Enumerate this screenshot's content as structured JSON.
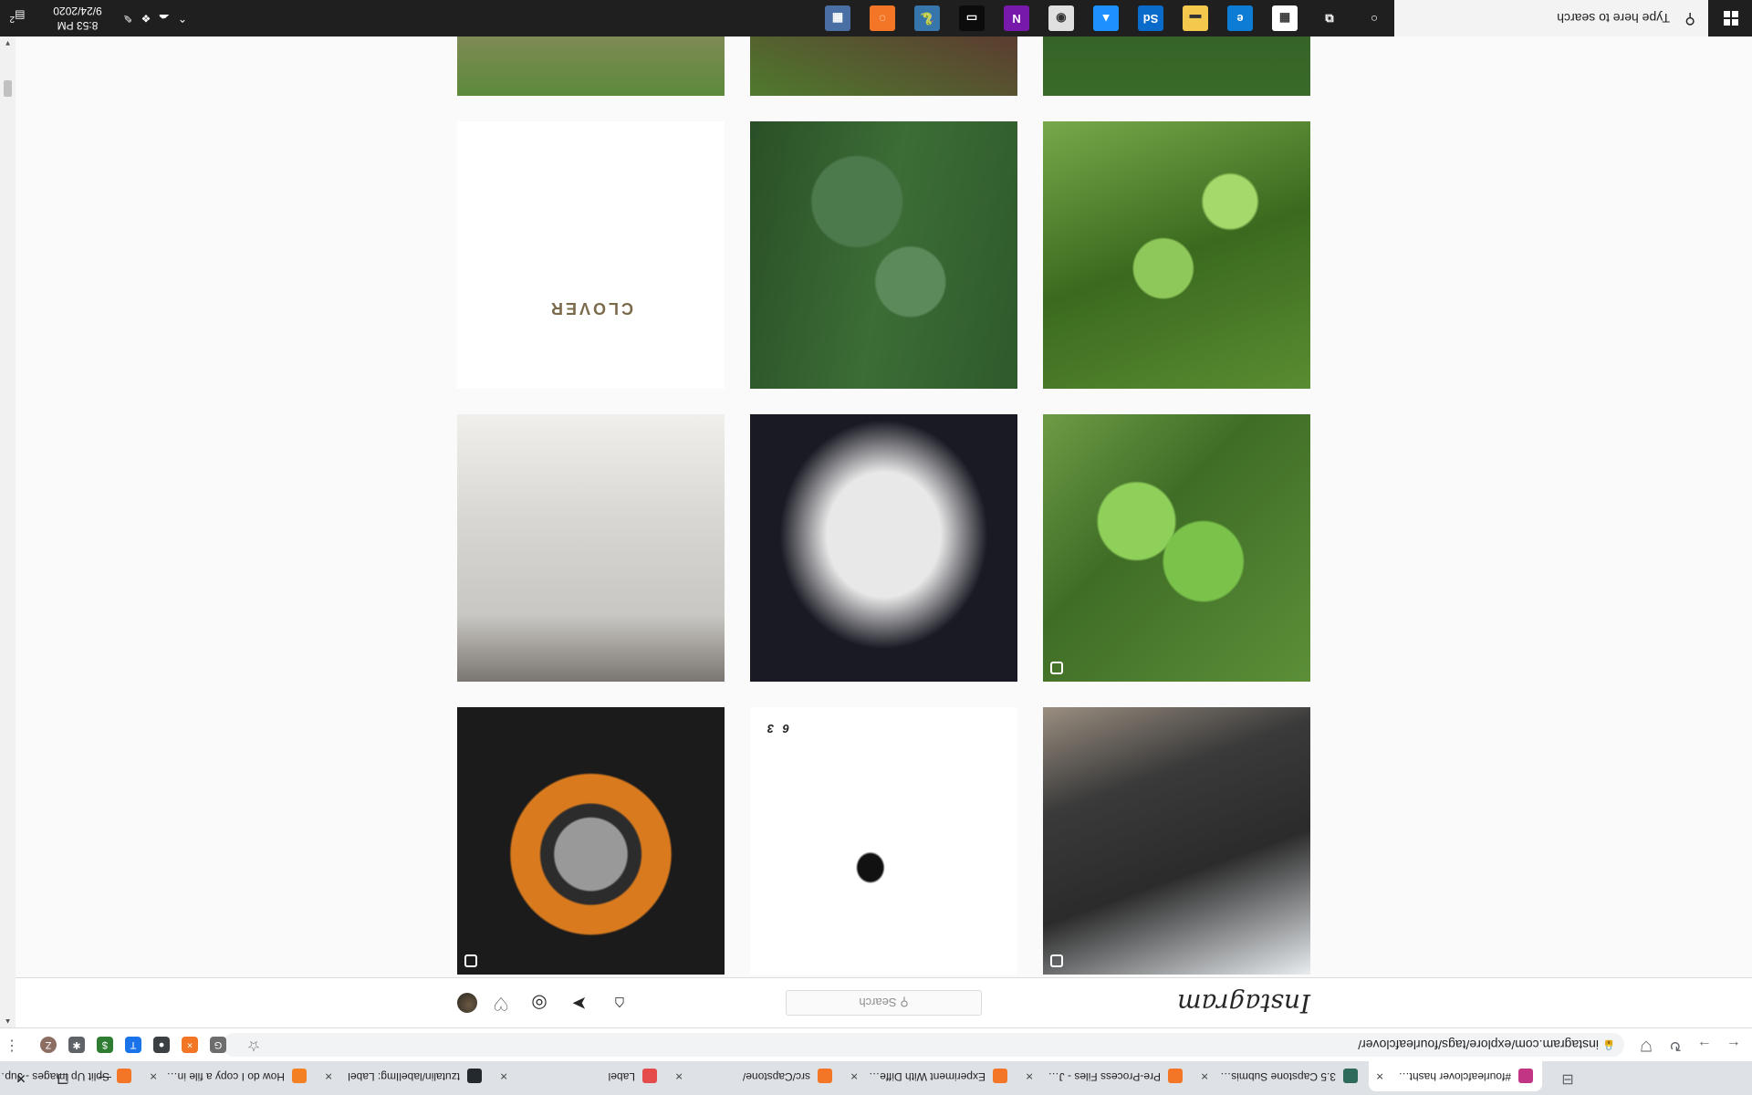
{
  "browser": {
    "tabs": [
      {
        "label": "#fourleafclover hashtag on",
        "favicon_color": "#c13584",
        "active": true
      },
      {
        "label": "3.5 Capstone Submission - ",
        "favicon_color": "#2e6b5a",
        "active": false
      },
      {
        "label": "Pre-Process Files - Jupyter",
        "favicon_color": "#f37626",
        "active": false
      },
      {
        "label": "Experiment With Different",
        "favicon_color": "#f37626",
        "active": false
      },
      {
        "label": "src/Capstone/",
        "favicon_color": "#f37626",
        "active": false
      },
      {
        "label": "Label",
        "favicon_color": "#e54b4b",
        "active": false
      },
      {
        "label": "tzutalin/labelImg: Label",
        "favicon_color": "#24292e",
        "active": false
      },
      {
        "label": "How do I copy a file in Pyth",
        "favicon_color": "#f48024",
        "active": false
      },
      {
        "label": "Split Up Images - Jupyter N",
        "favicon_color": "#f37626",
        "active": false
      }
    ],
    "url": "instagram.com/explore/tags/fourleafclover/",
    "extensions": [
      {
        "icon": "g-icon",
        "color": "#6d6d6d",
        "glyph": "G"
      },
      {
        "icon": "x-icon",
        "color": "#f37626",
        "glyph": "×"
      },
      {
        "icon": "circle-icon",
        "color": "#3c4043",
        "glyph": "●"
      },
      {
        "icon": "translate-icon",
        "color": "#1a73e8",
        "glyph": "T"
      },
      {
        "icon": "dollar-icon",
        "color": "#2e7d32",
        "glyph": "$"
      },
      {
        "icon": "puzzle-icon",
        "color": "#5f6368",
        "glyph": "✱"
      },
      {
        "icon": "profile-avatar",
        "color": "#8d6e63",
        "glyph": "Z"
      }
    ]
  },
  "instagram": {
    "logo": "Instagram",
    "search_placeholder": "Search",
    "search_icon_glyph": "⚲",
    "posts": [
      {
        "alt": "clover-bucket",
        "bg": "linear-gradient(160deg,#e8ecef 0%,#2b2b2b 40%,#3a3a3a 70%,#9a8e80 100%)"
      },
      {
        "alt": "clover-tattoo-drawing",
        "bg": "radial-gradient(ellipse at 55% 40%,#111 0 6%,#fff 7%) , #fff",
        "caption": "6 3"
      },
      {
        "alt": "clover-badge-anniversary",
        "bg": "radial-gradient(circle at 50% 45%,#999 0 18%,#2c2c2c 19% 25%,#d97a1e 26% 40%,#1b1b1b 41%)"
      },
      {
        "alt": "clover-patch-green",
        "bg": "radial-gradient(circle at 40% 45%,#7ac24a 0 18%,transparent 19%),radial-gradient(circle at 65% 60%,#8fd05a 0 16%,transparent 17%),linear-gradient(135deg,#5c8f38,#3f6d26 60%,#6d9b45)"
      },
      {
        "alt": "four-leaf-clover-selfie",
        "bg": "radial-gradient(ellipse at 50% 55%,#e8e8e8 0 30%,#1a1a24 55%),#22222c"
      },
      {
        "alt": "car-showroom",
        "bg": "linear-gradient(180deg,#7a7670 0%,#c9c7c3 25%,#d8d6d2 60%,#f0efec 100%)"
      },
      {
        "alt": "clover-grass-closeup",
        "bg": "radial-gradient(circle at 55% 45%,#8fc85a 0 14%,transparent 15%),radial-gradient(circle at 30% 70%,#a6d96b 0 10%,transparent 11%),linear-gradient(160deg,#5a8c32,#3b6a1e 50%,#77a84a)"
      },
      {
        "alt": "clover-in-grass",
        "bg": "radial-gradient(circle at 40% 40%,#5c8a5a 0 15%,transparent 16%),radial-gradient(circle at 60% 70%,#4d7a4d 0 18%,transparent 19%),linear-gradient(100deg,#2f5a2c,#3c6d36 50%,#2a4f27)"
      },
      {
        "alt": "clover-confetti",
        "bg": "#ffffff",
        "caption": "CLOVER"
      },
      {
        "alt": "clover-in-hand",
        "bg": "radial-gradient(circle at 55% 60%,#4a7a3a 0 20%,transparent 21%),linear-gradient(180deg,#3a6a2a,#2d5a22 60%,#d4a48a 85%,#e2b59a)"
      },
      {
        "alt": "clover-on-wood",
        "bg": "linear-gradient(200deg,#4f7a2e 0%,#5b4030 40%,#3d2a1e 100%)"
      },
      {
        "alt": "clover-shop-display",
        "bg": "linear-gradient(180deg,#5c8a3a 0%,#9a8a6a 40%,#d7c6a2 70%,#7ab0c8 100%)"
      }
    ],
    "multi_post_indices": [
      0,
      1,
      2,
      3
    ]
  },
  "taskbar": {
    "search_placeholder": "Type here to search",
    "time": "8:53 PM",
    "date": "9/24/2020",
    "notification_count": "2",
    "apps": [
      {
        "icon": "cortana-icon",
        "color": "#1f1f1f",
        "glyph": "○"
      },
      {
        "icon": "task-view-icon",
        "color": "#1f1f1f",
        "glyph": "⧉"
      },
      {
        "icon": "store-icon",
        "color": "#ffffff",
        "glyph": "▦"
      },
      {
        "icon": "edge-icon",
        "color": "#0c7cd5",
        "glyph": "e"
      },
      {
        "icon": "file-explorer-icon",
        "color": "#f2c94c",
        "glyph": "▬"
      },
      {
        "icon": "photoshop-icon",
        "color": "#0b6bcb",
        "glyph": "Sd"
      },
      {
        "icon": "photos-icon",
        "color": "#1e90ff",
        "glyph": "▲"
      },
      {
        "icon": "chrome-icon",
        "color": "#e0e0e0",
        "glyph": "◉"
      },
      {
        "icon": "onenote-icon",
        "color": "#7719aa",
        "glyph": "N"
      },
      {
        "icon": "terminal-icon",
        "color": "#0c0c0c",
        "glyph": "▭"
      },
      {
        "icon": "python-icon",
        "color": "#3776ab",
        "glyph": "🐍"
      },
      {
        "icon": "jupyter-icon",
        "color": "#f37626",
        "glyph": "◌"
      },
      {
        "icon": "calculator-icon",
        "color": "#4a6fa5",
        "glyph": "▦"
      }
    ]
  }
}
